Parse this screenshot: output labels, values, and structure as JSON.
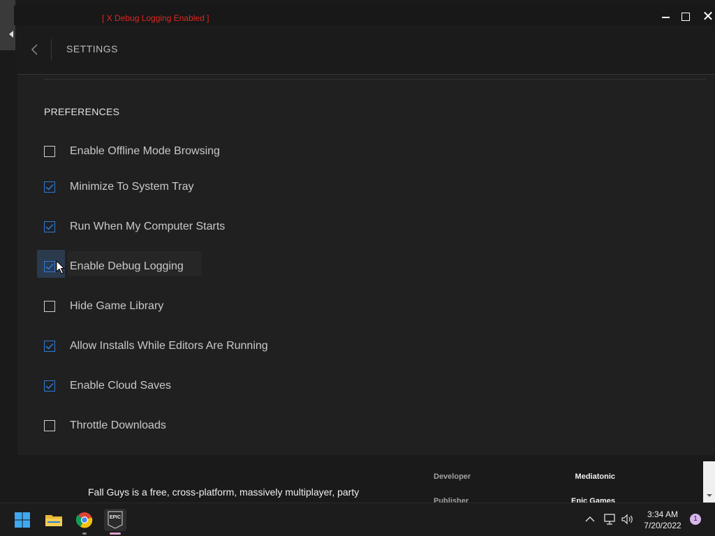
{
  "window": {
    "debug_banner": "[ X Debug Logging Enabled ]"
  },
  "settings": {
    "title": "SETTINGS",
    "section_title": "PREFERENCES",
    "preferences": [
      {
        "label": "Enable Offline Mode Browsing",
        "checked": false
      },
      {
        "label": "Minimize To System Tray",
        "checked": true
      },
      {
        "label": "Run When My Computer Starts",
        "checked": true
      },
      {
        "label": "Enable Debug Logging",
        "checked": true
      },
      {
        "label": "Hide Game Library",
        "checked": false
      },
      {
        "label": "Allow Installs While Editors Are Running",
        "checked": true
      },
      {
        "label": "Enable Cloud Saves",
        "checked": true
      },
      {
        "label": "Throttle Downloads",
        "checked": false
      }
    ]
  },
  "game": {
    "description": "Fall Guys is a free, cross-platform, massively multiplayer, party",
    "developer_label": "Developer",
    "developer_value": "Mediatonic",
    "publisher_label": "Publisher",
    "publisher_value": "Epic Games"
  },
  "taskbar": {
    "apps": [
      "start-icon",
      "file-explorer-icon",
      "chrome-icon",
      "epic-games-icon"
    ],
    "epic_label": "EPIC",
    "time": "3:34 AM",
    "date": "7/20/2022",
    "notification_count": "1"
  },
  "colors": {
    "accent": "#2f7bd8",
    "debug_red": "#e0261f",
    "panel_bg": "#202020"
  }
}
